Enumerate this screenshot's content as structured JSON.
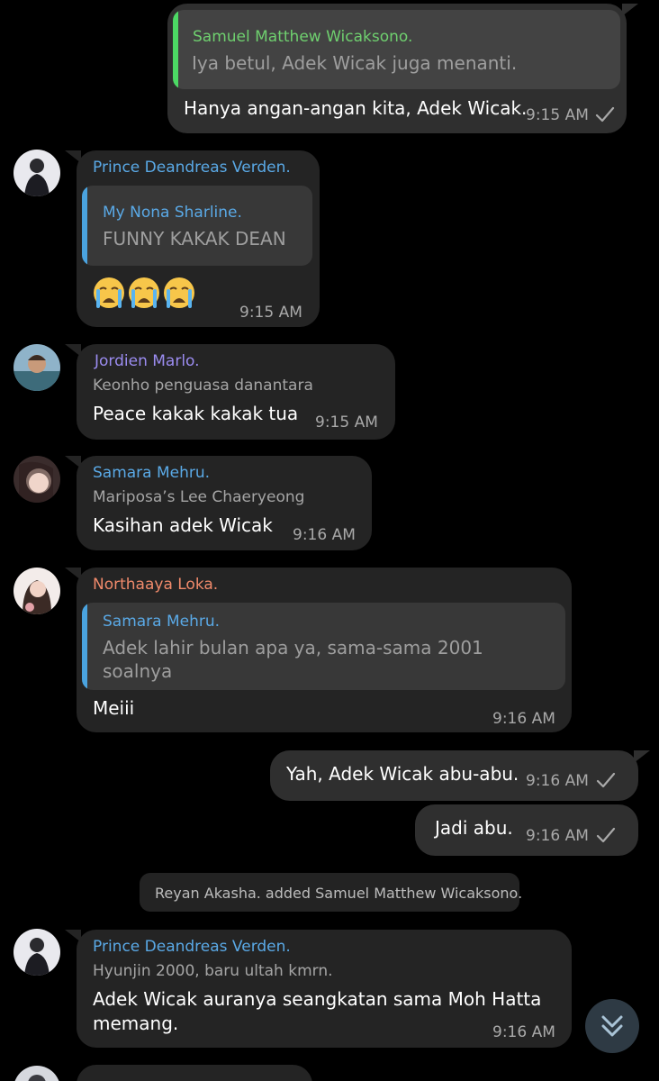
{
  "colors": {
    "background": "#000000",
    "incoming_bubble": "#242424",
    "outgoing_bubble": "#2f2f2f",
    "name_blue": "#5aa9e6",
    "name_green": "#6fd06f",
    "name_purple": "#9b8cf0",
    "name_orange": "#f08a6b",
    "quote_bar_green": "#4cd964",
    "quote_bar_blue": "#4aa3df"
  },
  "messages": [
    {
      "direction": "outgoing",
      "reply_to": {
        "sender": "Samuel Matthew Wicaksono.",
        "text": "Iya betul, Adek Wicak juga menanti."
      },
      "text": "Hanya angan-angan kita, Adek Wicak.",
      "time": "9:15 AM",
      "read_icon": "check-icon"
    },
    {
      "direction": "incoming",
      "sender": "Prince Deandreas Verden.",
      "reply_to": {
        "sender": "My Nona Sharline.",
        "text": "FUNNY KAKAK DEAN"
      },
      "emojis": [
        "crying-face-emoji",
        "crying-face-emoji",
        "crying-face-emoji"
      ],
      "time": "9:15 AM"
    },
    {
      "direction": "incoming",
      "sender": "Jordien Marlo.",
      "title": "Keonho penguasa danantara",
      "text": "Peace kakak kakak tua",
      "time": "9:15 AM"
    },
    {
      "direction": "incoming",
      "sender": "Samara Mehru.",
      "title": "Mariposa’s Lee Chaeryeong",
      "text": "Kasihan adek Wicak",
      "time": "9:16 AM"
    },
    {
      "direction": "incoming",
      "sender": "Northaaya Loka.",
      "reply_to": {
        "sender": "Samara Mehru.",
        "text_line1": "Adek lahir bulan apa ya, sama-sama 2001",
        "text_line2": "soalnya"
      },
      "text": "Meiii",
      "time": "9:16 AM"
    },
    {
      "direction": "outgoing",
      "text": "Yah, Adek Wicak abu-abu.",
      "time": "9:16 AM",
      "read_icon": "check-icon"
    },
    {
      "direction": "outgoing",
      "text": "Jadi abu.",
      "time": "9:16 AM",
      "read_icon": "check-icon"
    },
    {
      "direction": "incoming",
      "sender": "Prince Deandreas Verden.",
      "title": "Hyunjin 2000, baru ultah kmrn.",
      "text_line1": "Adek Wicak auranya seangkatan sama Moh Hatta",
      "text_line2": "memang.",
      "time": "9:16 AM"
    }
  ],
  "service_message": "Reyan Akasha. added Samuel Matthew Wicaksono.",
  "scroll_down_icon": "double-chevron-down-icon"
}
